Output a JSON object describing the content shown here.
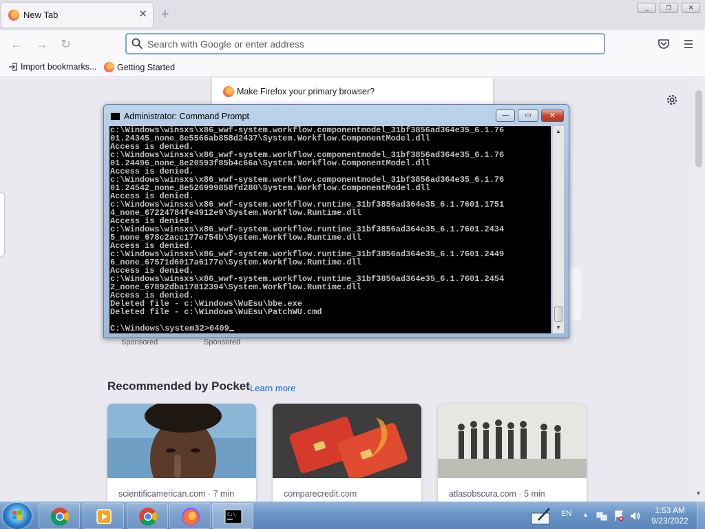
{
  "firefox": {
    "tab": {
      "title": "New Tab",
      "close": "✕"
    },
    "new_tab": "+",
    "nav": {
      "back": "←",
      "forward": "→",
      "reload": "↻"
    },
    "urlbar": {
      "placeholder": "Search with Google or enter address",
      "value": ""
    },
    "bookmarks": [
      {
        "label": "Import bookmarks...",
        "icon": "import-icon"
      },
      {
        "label": "Getting Started",
        "icon": "firefox-icon"
      }
    ],
    "promo": {
      "text": "Make Firefox your primary browser?"
    },
    "sponsored": [
      "Sponsored",
      "Sponsored"
    ],
    "pocket": {
      "title": "Recommended by Pocket",
      "learn_more": "Learn more",
      "cards": [
        {
          "source": "scientificamerican.com · 7 min"
        },
        {
          "source": "comparecredit.com"
        },
        {
          "source": "atlasobscura.com · 5 min"
        }
      ]
    },
    "colors": {
      "accent": "#0060df",
      "urlbar_border": "#7fa6dc"
    }
  },
  "cmd": {
    "title": "Administrator: Command Prompt",
    "lines": [
      "c:\\Windows\\winsxs\\x86_wwf-system.workflow.componentmodel_31bf3856ad364e35_6.1.76",
      "01.24345_none_8e5566ab858d2437\\System.Workflow.ComponentModel.dll",
      "Access is denied.",
      "c:\\Windows\\winsxs\\x86_wwf-system.workflow.componentmodel_31bf3856ad364e35_6.1.76",
      "01.24496_none_8e20593f85b4c66a\\System.Workflow.ComponentModel.dll",
      "Access is denied.",
      "c:\\Windows\\winsxs\\x86_wwf-system.workflow.componentmodel_31bf3856ad364e35_6.1.76",
      "01.24542_none_8e526999858fd280\\System.Workflow.ComponentModel.dll",
      "Access is denied.",
      "c:\\Windows\\winsxs\\x86_wwf-system.workflow.runtime_31bf3856ad364e35_6.1.7601.1751",
      "4_none_67224784fe4912e9\\System.Workflow.Runtime.dll",
      "Access is denied.",
      "c:\\Windows\\winsxs\\x86_wwf-system.workflow.runtime_31bf3856ad364e35_6.1.7601.2434",
      "5_none_678c2acc177e754b\\System.Workflow.Runtime.dll",
      "Access is denied.",
      "c:\\Windows\\winsxs\\x86_wwf-system.workflow.runtime_31bf3856ad364e35_6.1.7601.2449",
      "6_none_67571d6017a6177e\\System.Workflow.Runtime.dll",
      "Access is denied.",
      "c:\\Windows\\winsxs\\x86_wwf-system.workflow.runtime_31bf3856ad364e35_6.1.7601.2454",
      "2_none_67892dba17812394\\System.Workflow.Runtime.dll",
      "Access is denied.",
      "Deleted file - c:\\Windows\\WuEsu\\bbe.exe",
      "Deleted file - c:\\Windows\\WuEsu\\PatchWU.cmd"
    ],
    "prompt": "C:\\Windows\\system32>0409",
    "buttons": {
      "minimize": "—",
      "maximize": "▭",
      "close": "✕"
    }
  },
  "taskbar": {
    "items": [
      {
        "name": "chrome-pinned",
        "icon": "chrome-icon"
      },
      {
        "name": "media-player",
        "icon": "media-icon"
      },
      {
        "name": "chrome",
        "icon": "chrome-icon"
      },
      {
        "name": "firefox",
        "icon": "firefox-icon"
      },
      {
        "name": "command-prompt",
        "icon": "cmd-icon"
      }
    ],
    "language": "EN",
    "clock": {
      "time": "1:53 AM",
      "date": "9/23/2022"
    }
  }
}
